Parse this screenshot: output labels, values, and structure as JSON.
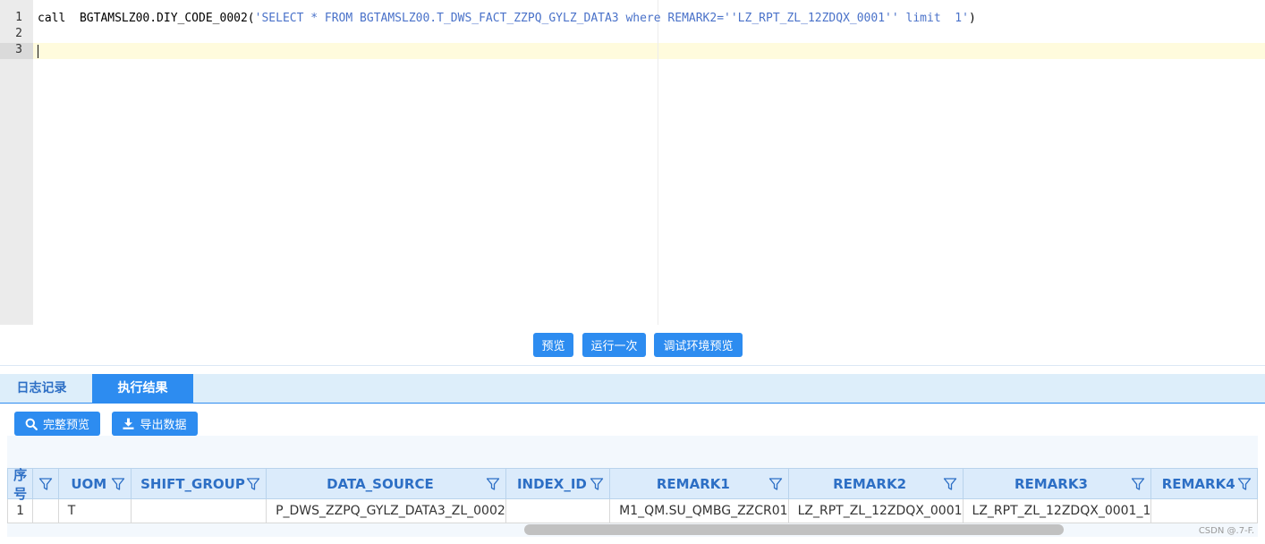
{
  "editor": {
    "line_numbers": [
      "1",
      "2",
      "3"
    ],
    "code_prefix": "call  BGTAMSLZ00.DIY_CODE_0002(",
    "code_string": "'SELECT * FROM BGTAMSLZ00.T_DWS_FACT_ZZPQ_GYLZ_DATA3 where REMARK2=''LZ_RPT_ZL_12ZDQX_0001'' limit  1'",
    "code_suffix": ")",
    "active_line_color": "#fffbdd",
    "string_color": "#4a72c9"
  },
  "actions": {
    "preview": "预览",
    "run_once": "运行一次",
    "debug_preview": "调试环境预览"
  },
  "tabs": [
    {
      "label": "日志记录",
      "active": false
    },
    {
      "label": "执行结果",
      "active": true
    }
  ],
  "toolbar": {
    "full_preview": "完整预览",
    "export_data": "导出数据",
    "full_preview_icon": "search-icon",
    "export_data_icon": "download-icon"
  },
  "table": {
    "columns": [
      {
        "label": "序号"
      },
      {
        "label": ""
      },
      {
        "label": "UOM"
      },
      {
        "label": "SHIFT_GROUP"
      },
      {
        "label": "DATA_SOURCE"
      },
      {
        "label": "INDEX_ID"
      },
      {
        "label": "REMARK1"
      },
      {
        "label": "REMARK2"
      },
      {
        "label": "REMARK3"
      },
      {
        "label": "REMARK4"
      }
    ],
    "rows": [
      [
        "1",
        "",
        "T",
        "",
        "P_DWS_ZZPQ_GYLZ_DATA3_ZL_0002",
        "",
        "M1_QM.SU_QMBG_ZZCR01",
        "LZ_RPT_ZL_12ZDQX_0001",
        "LZ_RPT_ZL_12ZDQX_0001_1",
        ""
      ]
    ]
  },
  "colors": {
    "accent": "#2d8cf0",
    "header_text": "#2d6fc5",
    "header_bg": "#dbebfb",
    "tabbar_bg": "#ddeefa"
  },
  "watermark": "CSDN @.7-F."
}
